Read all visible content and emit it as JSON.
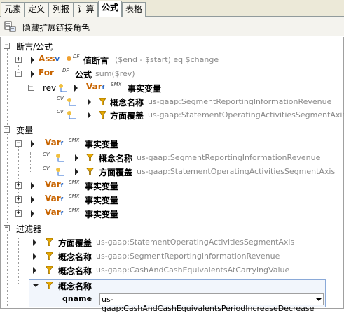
{
  "tabs": [
    "元素",
    "定义",
    "列报",
    "计算",
    "公式",
    "表格"
  ],
  "active_tab": "公式",
  "toolbar": {
    "label": "隐藏扩展链接角色"
  },
  "sections": {
    "assertions": "断言/公式",
    "variables": "变量",
    "filters": "过滤器"
  },
  "assertions": [
    {
      "kw": "Ass",
      "sub": "V",
      "flags": "DF",
      "title": "值断言",
      "expr": "($end - $start) eq $change"
    },
    {
      "kw": "For",
      "sub": "",
      "flags": "DF",
      "title": "公式",
      "expr": "sum($rev)"
    }
  ],
  "formula_child": {
    "var_name": "rev",
    "kw": "Var",
    "sub": "f",
    "flags": "SMX",
    "title": "事实变量",
    "filters": [
      {
        "flags": "CV",
        "title": "概念名称",
        "value": "us-gaap:SegmentReportingInformationRevenue"
      },
      {
        "flags": "CV",
        "title": "方面覆盖",
        "value": "us-gaap:StatementOperatingActivitiesSegmentAxis"
      }
    ]
  },
  "variables": [
    {
      "kw": "Var",
      "sub": "f",
      "flags": "SMX",
      "title": "事实变量"
    },
    {
      "kw": "Var",
      "sub": "f",
      "flags": "SMX",
      "title": "事实变量"
    },
    {
      "kw": "Var",
      "sub": "f",
      "flags": "SMX",
      "title": "事实变量"
    },
    {
      "kw": "Var",
      "sub": "f",
      "flags": "SMX",
      "title": "事实变量"
    }
  ],
  "variable_child_filters": [
    {
      "flags": "CV",
      "title": "概念名称",
      "value": "us-gaap:SegmentReportingInformationRevenue"
    },
    {
      "flags": "CV",
      "title": "方面覆盖",
      "value": "us-gaap:StatementOperatingActivitiesSegmentAxis"
    }
  ],
  "filters": [
    {
      "title": "方面覆盖",
      "value": "us-gaap:StatementOperatingActivitiesSegmentAxis"
    },
    {
      "title": "概念名称",
      "value": "us-gaap:SegmentReportingInformationRevenue"
    },
    {
      "title": "概念名称",
      "value": "us-gaap:CashAndCashEquivalentsAtCarryingValue"
    },
    {
      "title": "概念名称",
      "value": ""
    }
  ],
  "selected_filter": {
    "sub_label": "qname",
    "value": "us-gaap:CashAndCashEquivalentsPeriodIncreaseDecrease"
  },
  "colors": {
    "keyword": "#c86400",
    "funnel": "#e6a800",
    "gray_text": "#8a8a8a"
  }
}
